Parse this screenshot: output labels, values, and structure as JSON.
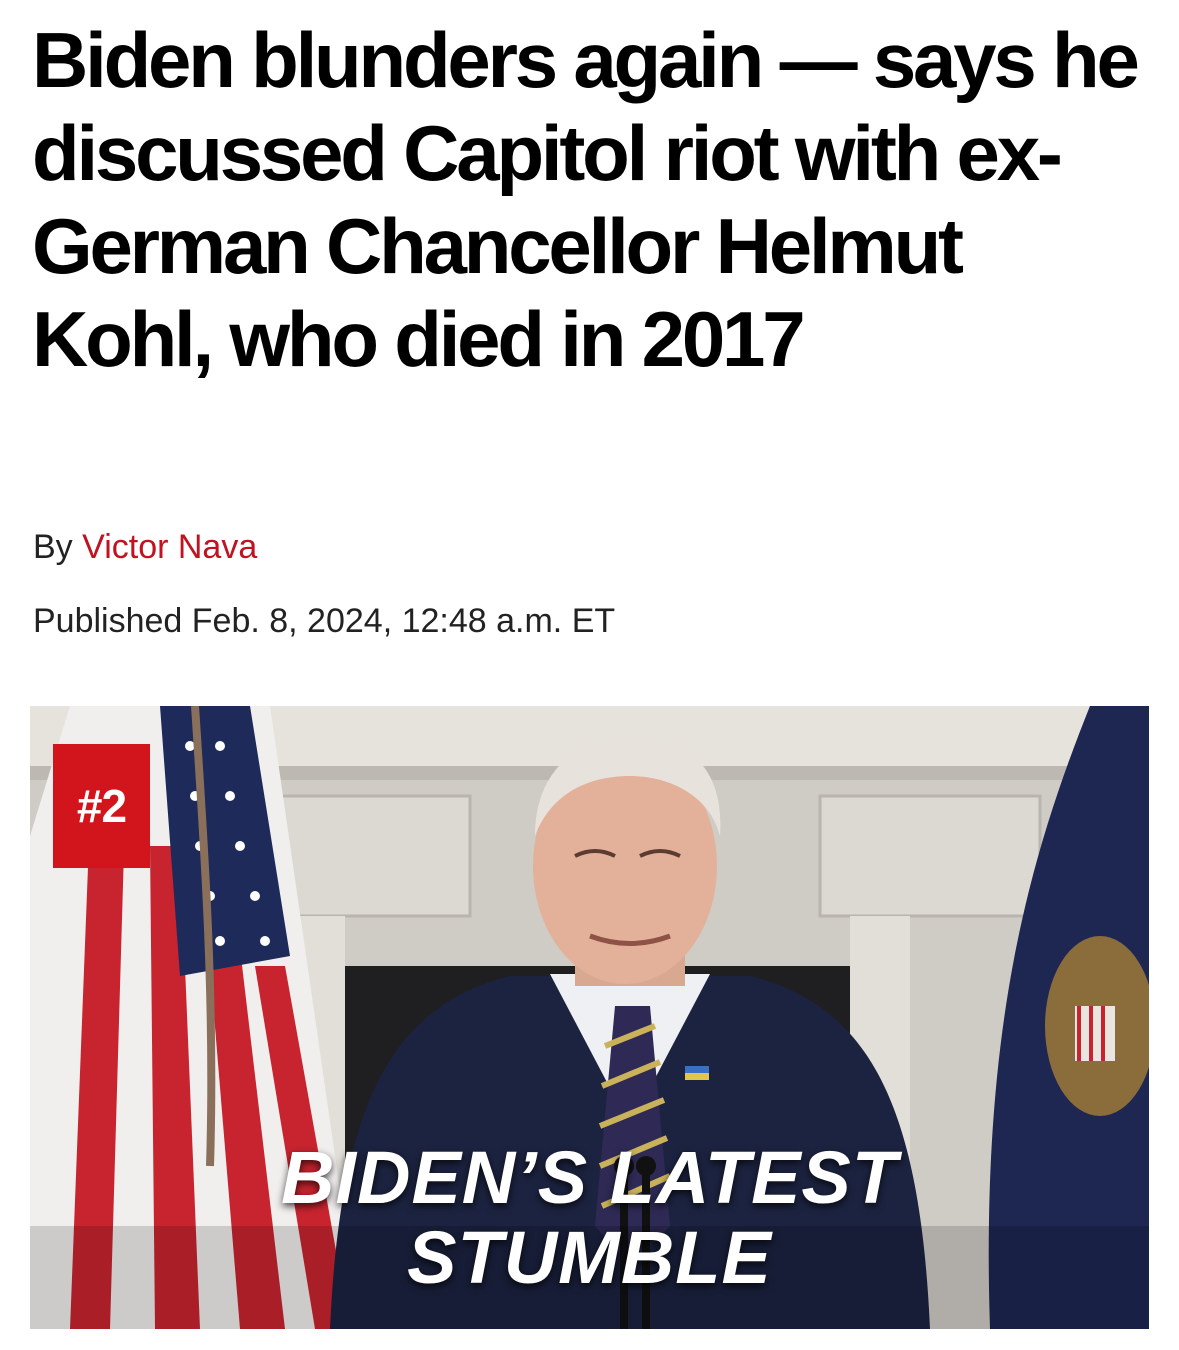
{
  "article": {
    "headline": "Biden blunders again — says he discussed Capitol riot with ex-German Chancellor Helmut Kohl, who died in 2017",
    "byline_prefix": "By ",
    "author": "Victor Nava",
    "published": "Published Feb. 8, 2024, 12:48 a.m. ET"
  },
  "hero": {
    "badge": "#2",
    "caption_line1": "BIDEN’S LATEST",
    "caption_line2": "STUMBLE"
  },
  "colors": {
    "accent_red": "#c1121f",
    "badge_red": "#d2141c"
  }
}
